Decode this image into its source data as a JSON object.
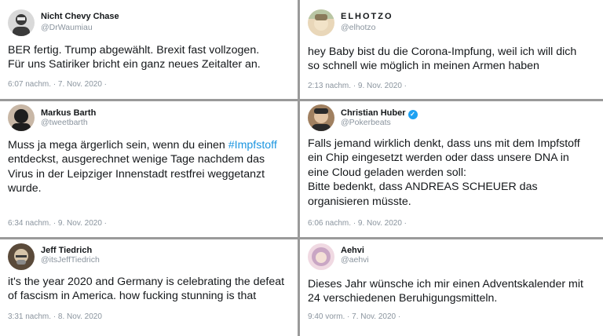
{
  "tweets": [
    {
      "name": "Nicht Chevy Chase",
      "handle": "@DrWaumiau",
      "text_lines": [
        "BER fertig. Trump abgewählt. Brexit fast vollzogen.",
        "Für uns Satiriker bricht ein ganz neues Zeitalter an."
      ],
      "meta": "6:07 nachm. · 7. Nov. 2020 ·",
      "avatar_icon": "avatar-photo-icon",
      "avatar_colors": [
        "#3a3a3a",
        "#d9d9d9"
      ]
    },
    {
      "name": "ELHOTZO",
      "handle": "@elhotzo",
      "text_lines": [
        "hey Baby bist du die Corona-Impfung, weil ich will dich",
        "so schnell wie möglich in meinen Armen haben"
      ],
      "meta": "2:13 nachm. · 9. Nov. 2020 ·",
      "avatar_icon": "avatar-photo-icon",
      "avatar_colors": [
        "#b9c6a4",
        "#e9d7b9"
      ]
    },
    {
      "name": "Markus Barth",
      "handle": "@tweetbarth",
      "text_before": "Muss ja mega ärgerlich sein, wenn du einen ",
      "hashtag": "#Impfstoff",
      "text_after_lines": [
        "entdeckst, ausgerechnet wenige Tage nachdem das",
        "Virus in der Leipziger Innenstadt restfrei weggetanzt",
        "wurde."
      ],
      "meta": "6:34 nachm. · 9. Nov. 2020 ·",
      "avatar_icon": "avatar-photo-icon",
      "avatar_colors": [
        "#1e1e1e",
        "#c8b7a6"
      ]
    },
    {
      "name": "Christian Huber",
      "handle": "@Pokerbeats",
      "verified_icon": "verified-badge-icon",
      "text_lines": [
        "Falls jemand wirklich denkt, dass uns mit dem Impfstoff",
        "ein Chip eingesetzt werden oder dass unsere DNA in",
        "eine Cloud geladen werden soll:",
        "Bitte bedenkt, dass ANDREAS SCHEUER das",
        "organisieren müsste."
      ],
      "meta": "6:06 nachm. · 9. Nov. 2020 ·",
      "avatar_icon": "avatar-photo-icon",
      "avatar_colors": [
        "#2a2a2a",
        "#a08060"
      ]
    },
    {
      "name": "Jeff Tiedrich",
      "handle": "@itsJeffTiedrich",
      "text_lines": [
        "it's the year 2020 and Germany is celebrating the defeat",
        "of fascism in America. how fucking stunning is that"
      ],
      "meta": "3:31 nachm. · 8. Nov. 2020",
      "avatar_icon": "avatar-photo-icon",
      "avatar_colors": [
        "#5a4a3a",
        "#d6c4a8"
      ]
    },
    {
      "name": "Aehvi",
      "handle": "@aehvi",
      "text_lines": [
        "Dieses Jahr wünsche ich mir einen Adventskalender mit",
        "24 verschiedenen Beruhigungsmitteln."
      ],
      "meta": "9:40 vorm. · 7. Nov. 2020 ·",
      "avatar_icon": "avatar-photo-icon",
      "avatar_colors": [
        "#c9a6c4",
        "#f0d9e2"
      ]
    }
  ]
}
